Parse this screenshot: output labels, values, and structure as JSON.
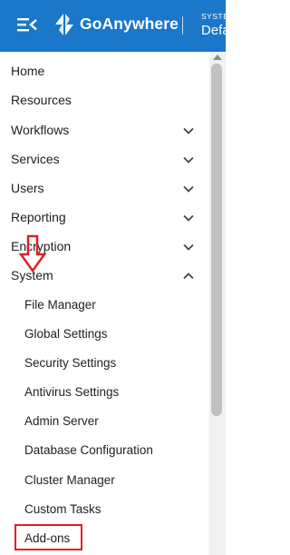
{
  "header": {
    "brand": "GoAnywhere",
    "context_label": "SYSTE",
    "context_value": "Defa",
    "menu_icon": "menu-collapse-icon",
    "logo_icon": "goanywhere-logo-icon",
    "background_color": "#1a77c9"
  },
  "nav": {
    "items": [
      {
        "label": "Home",
        "chevron": "none"
      },
      {
        "label": "Resources",
        "chevron": "none"
      },
      {
        "label": "Workflows",
        "chevron": "down"
      },
      {
        "label": "Services",
        "chevron": "down"
      },
      {
        "label": "Users",
        "chevron": "down"
      },
      {
        "label": "Reporting",
        "chevron": "down"
      },
      {
        "label": "Encryption",
        "chevron": "down"
      },
      {
        "label": "System",
        "chevron": "up",
        "expanded": true
      }
    ],
    "system_subitems": [
      "File Manager",
      "Global Settings",
      "Security Settings",
      "Antivirus Settings",
      "Admin Server",
      "Database Configuration",
      "Cluster Manager",
      "Custom Tasks",
      "Add-ons"
    ]
  },
  "annotations": {
    "highlight_color": "#e41e26",
    "highlighted_item": "Add-ons",
    "arrow_icon": "red-down-arrow-icon"
  }
}
